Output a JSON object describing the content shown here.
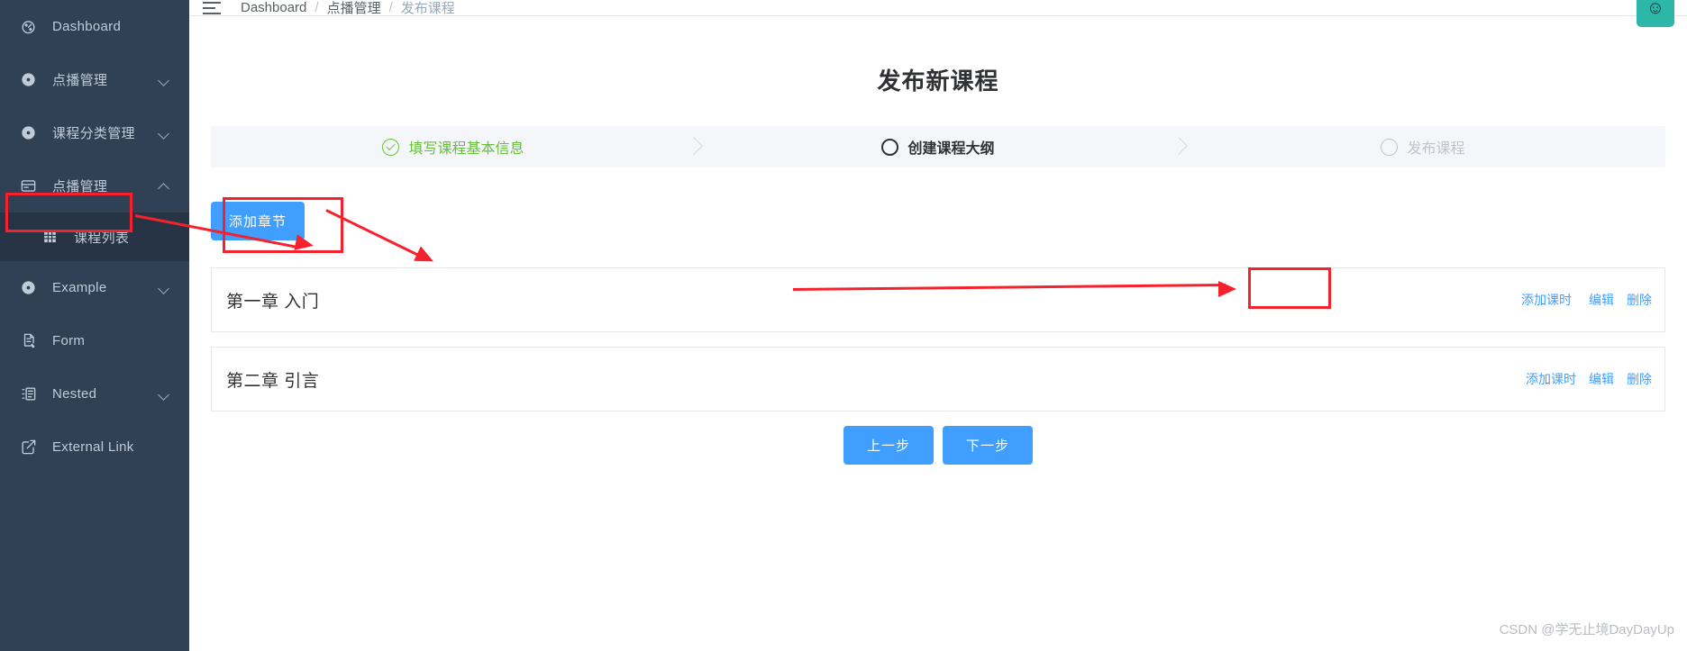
{
  "sidebar": {
    "items": [
      {
        "label": "Dashboard",
        "icon": "dashboard-icon",
        "arrow": "none",
        "active": false,
        "child": false
      },
      {
        "label": "点播管理",
        "icon": "compass-icon",
        "arrow": "down",
        "active": false,
        "child": false
      },
      {
        "label": "课程分类管理",
        "icon": "compass-icon",
        "arrow": "down",
        "active": false,
        "child": false
      },
      {
        "label": "点播管理",
        "icon": "card-icon",
        "arrow": "up",
        "active": false,
        "child": false
      },
      {
        "label": "课程列表",
        "icon": "table-icon",
        "arrow": "none",
        "active": true,
        "child": true
      },
      {
        "label": "Example",
        "icon": "compass-icon",
        "arrow": "down",
        "active": false,
        "child": false
      },
      {
        "label": "Form",
        "icon": "form-icon",
        "arrow": "none",
        "active": false,
        "child": false
      },
      {
        "label": "Nested",
        "icon": "nested-icon",
        "arrow": "down",
        "active": false,
        "child": false
      },
      {
        "label": "External Link",
        "icon": "external-link-icon",
        "arrow": "none",
        "active": false,
        "child": false
      }
    ]
  },
  "navbar": {
    "hamburger": "hamburger-icon",
    "breadcrumb": [
      {
        "label": "Dashboard",
        "muted": false
      },
      {
        "label": "点播管理",
        "muted": false
      },
      {
        "label": "发布课程",
        "muted": true
      }
    ],
    "separator": "/",
    "avatar_glyph": "☺"
  },
  "page": {
    "title": "发布新课程"
  },
  "steps": [
    {
      "label": "填写课程基本信息",
      "state": "done"
    },
    {
      "label": "创建课程大纲",
      "state": "active"
    },
    {
      "label": "发布课程",
      "state": "pending"
    }
  ],
  "toolbar": {
    "add_chapter_label": "添加章节"
  },
  "chapters": [
    {
      "title": "第一章 入门",
      "actions": [
        {
          "label": "添加课时",
          "highlighted": true
        },
        {
          "label": "编辑",
          "highlighted": false
        },
        {
          "label": "删除",
          "highlighted": false
        }
      ]
    },
    {
      "title": "第二章 引言",
      "actions": [
        {
          "label": "添加课时",
          "highlighted": false
        },
        {
          "label": "编辑",
          "highlighted": false
        },
        {
          "label": "删除",
          "highlighted": false
        }
      ]
    }
  ],
  "footer": {
    "prev_label": "上一步",
    "next_label": "下一步"
  },
  "watermark": "CSDN @学无止境DayDayUp",
  "colors": {
    "sidebar_bg": "#304156",
    "sidebar_active_bg": "#263445",
    "primary": "#409eff",
    "success": "#67c23a",
    "annotation": "#f5222d"
  }
}
